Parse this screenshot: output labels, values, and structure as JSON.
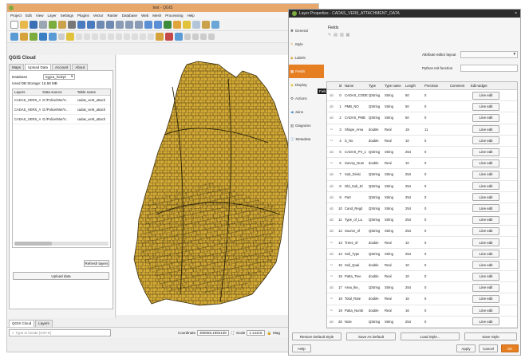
{
  "main_window": {
    "title": "test - QGIS",
    "menu": [
      "Project",
      "Edit",
      "View",
      "Layer",
      "Settings",
      "Plugins",
      "Vector",
      "Raster",
      "Database",
      "Web",
      "Mesh",
      "Processing",
      "Help"
    ],
    "panel_title": "QGIS Cloud",
    "panel_tabs": [
      "Maps",
      "Upload Data",
      "Account",
      "About"
    ],
    "database_label": "Database",
    "database_value": "kgyra_fvdzpl",
    "storage_text": "Used DB Storage: 16.58 MB",
    "table_headers": [
      "Layers",
      "Data source",
      "Table name"
    ],
    "table_rows": [
      [
        "CADAS_VERS_A...",
        "D:/Police/Mer/V...",
        "cadas_ver8_attach"
      ],
      [
        "CADAS_VERS_A...",
        "D:/Police/Mer/V...",
        "cadas_ver8_attach"
      ],
      [
        "CADAS_VERS_A...",
        "D:/Police/Mer/V...",
        "cadas_ver8_attach"
      ]
    ],
    "refresh_label": "Refresh layers",
    "upload_label": "Upload data",
    "bottom_tabs": [
      "QGIS Cloud",
      "Layers"
    ],
    "search_placeholder": "Type to locate (Ctrl+K)",
    "coordinate_label": "Coordinate",
    "coordinate_value": "305059,1994138",
    "scale_label": "Scale",
    "scale_value": "1:14416",
    "render_label": "Mag",
    "polygon_color": "#d3a935"
  },
  "dialog": {
    "title": "Layer Properties - CADAS_VER8_ATTACHMENT_DATA",
    "nav": [
      "General",
      "Style",
      "Labels",
      "Fields",
      "Display",
      "Actions",
      "Joins",
      "Diagrams",
      "Metadata"
    ],
    "active_nav": "Fields",
    "tooltip": "Fields",
    "section_title": "Fields",
    "attr_editor_label": "Attribute editor layout",
    "python_init_label": "Python Init function",
    "columns": [
      "Id",
      "Name",
      "Type",
      "Type name",
      "Length",
      "Precision",
      "Comment",
      "Edit widget"
    ],
    "rows": [
      [
        "0",
        "CADAS_CODE",
        "QString",
        "String",
        "50",
        "0",
        "",
        "Line edit"
      ],
      [
        "1",
        "PMB_NO",
        "QString",
        "String",
        "50",
        "0",
        "",
        "Line edit"
      ],
      [
        "2",
        "CADAS_PMB",
        "QString",
        "String",
        "50",
        "0",
        "",
        "Line edit"
      ],
      [
        "3",
        "Shape_Area",
        "double",
        "Real",
        "19",
        "11",
        "",
        "Line edit"
      ],
      [
        "4",
        "S_No",
        "double",
        "Real",
        "10",
        "0",
        "",
        "Line edit"
      ],
      [
        "5",
        "CADAS_PV_1",
        "QString",
        "String",
        "254",
        "0",
        "",
        "Line edit"
      ],
      [
        "6",
        "Survey_Num",
        "double",
        "Real",
        "10",
        "0",
        "",
        "Line edit"
      ],
      [
        "7",
        "Sub_Divisi",
        "QString",
        "String",
        "254",
        "0",
        "",
        "Line edit"
      ],
      [
        "8",
        "Old_Sub_Di",
        "QString",
        "String",
        "254",
        "0",
        "",
        "Line edit"
      ],
      [
        "9",
        "Part",
        "QString",
        "String",
        "254",
        "0",
        "",
        "Line edit"
      ],
      [
        "10",
        "Cand_Regd",
        "QString",
        "String",
        "254",
        "0",
        "",
        "Line edit"
      ],
      [
        "11",
        "Type_of_La",
        "QString",
        "String",
        "254",
        "0",
        "",
        "Line edit"
      ],
      [
        "12",
        "Source_of",
        "QString",
        "String",
        "254",
        "0",
        "",
        "Line edit"
      ],
      [
        "13",
        "Trees_of",
        "double",
        "Real",
        "10",
        "0",
        "",
        "Line edit"
      ],
      [
        "14",
        "Soil_Type",
        "QString",
        "String",
        "254",
        "0",
        "",
        "Line edit"
      ],
      [
        "15",
        "Soil_Qual",
        "double",
        "Real",
        "10",
        "0",
        "",
        "Line edit"
      ],
      [
        "16",
        "Patta_Tree",
        "double",
        "Real",
        "10",
        "0",
        "",
        "Line edit"
      ],
      [
        "17",
        "Area_lke_",
        "QString",
        "String",
        "254",
        "0",
        "",
        "Line edit"
      ],
      [
        "18",
        "Total_Rate",
        "double",
        "Real",
        "16",
        "0",
        "",
        "Line edit"
      ],
      [
        "19",
        "Patta_Numb",
        "double",
        "Real",
        "16",
        "0",
        "",
        "Line edit"
      ],
      [
        "20",
        "Note",
        "QString",
        "String",
        "254",
        "0",
        "",
        "Line edit"
      ]
    ],
    "restore_default_style": "Restore Default Style",
    "save_as_default": "Save As Default",
    "load_style": "Load Style...",
    "save_style": "Save Style",
    "help": "Help",
    "apply": "Apply",
    "cancel": "Cancel",
    "ok": "OK",
    "ok_color": "#e67e22"
  }
}
